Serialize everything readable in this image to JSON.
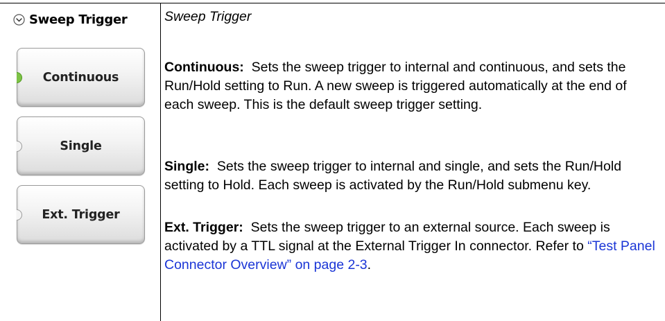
{
  "menu": {
    "title": "Sweep Trigger",
    "buttons": [
      {
        "label": "Continuous",
        "active": true
      },
      {
        "label": "Single",
        "active": false
      },
      {
        "label": "Ext. Trigger",
        "active": false
      }
    ]
  },
  "content": {
    "title": "Sweep Trigger",
    "continuous": {
      "term": "Continuous:",
      "text": "Sets the sweep trigger to internal and continuous, and sets the Run/Hold setting to Run. A new sweep is triggered automatically at the end of each sweep. This is the default sweep trigger setting."
    },
    "single": {
      "term": "Single:",
      "text": "Sets the sweep trigger to internal and single, and sets the Run/Hold setting to Hold. Each sweep is activated by the Run/Hold submenu key."
    },
    "ext_trigger": {
      "term": "Ext. Trigger:",
      "text": "Sets the sweep trigger to an external source. Each sweep is activated by a TTL signal at the External Trigger In connector. Refer to",
      "link": "“Test Panel Connector Overview” on page 2-3",
      "end": "."
    }
  },
  "colors": {
    "link": "#1a35d6",
    "active_indicator": "#7dc246"
  }
}
